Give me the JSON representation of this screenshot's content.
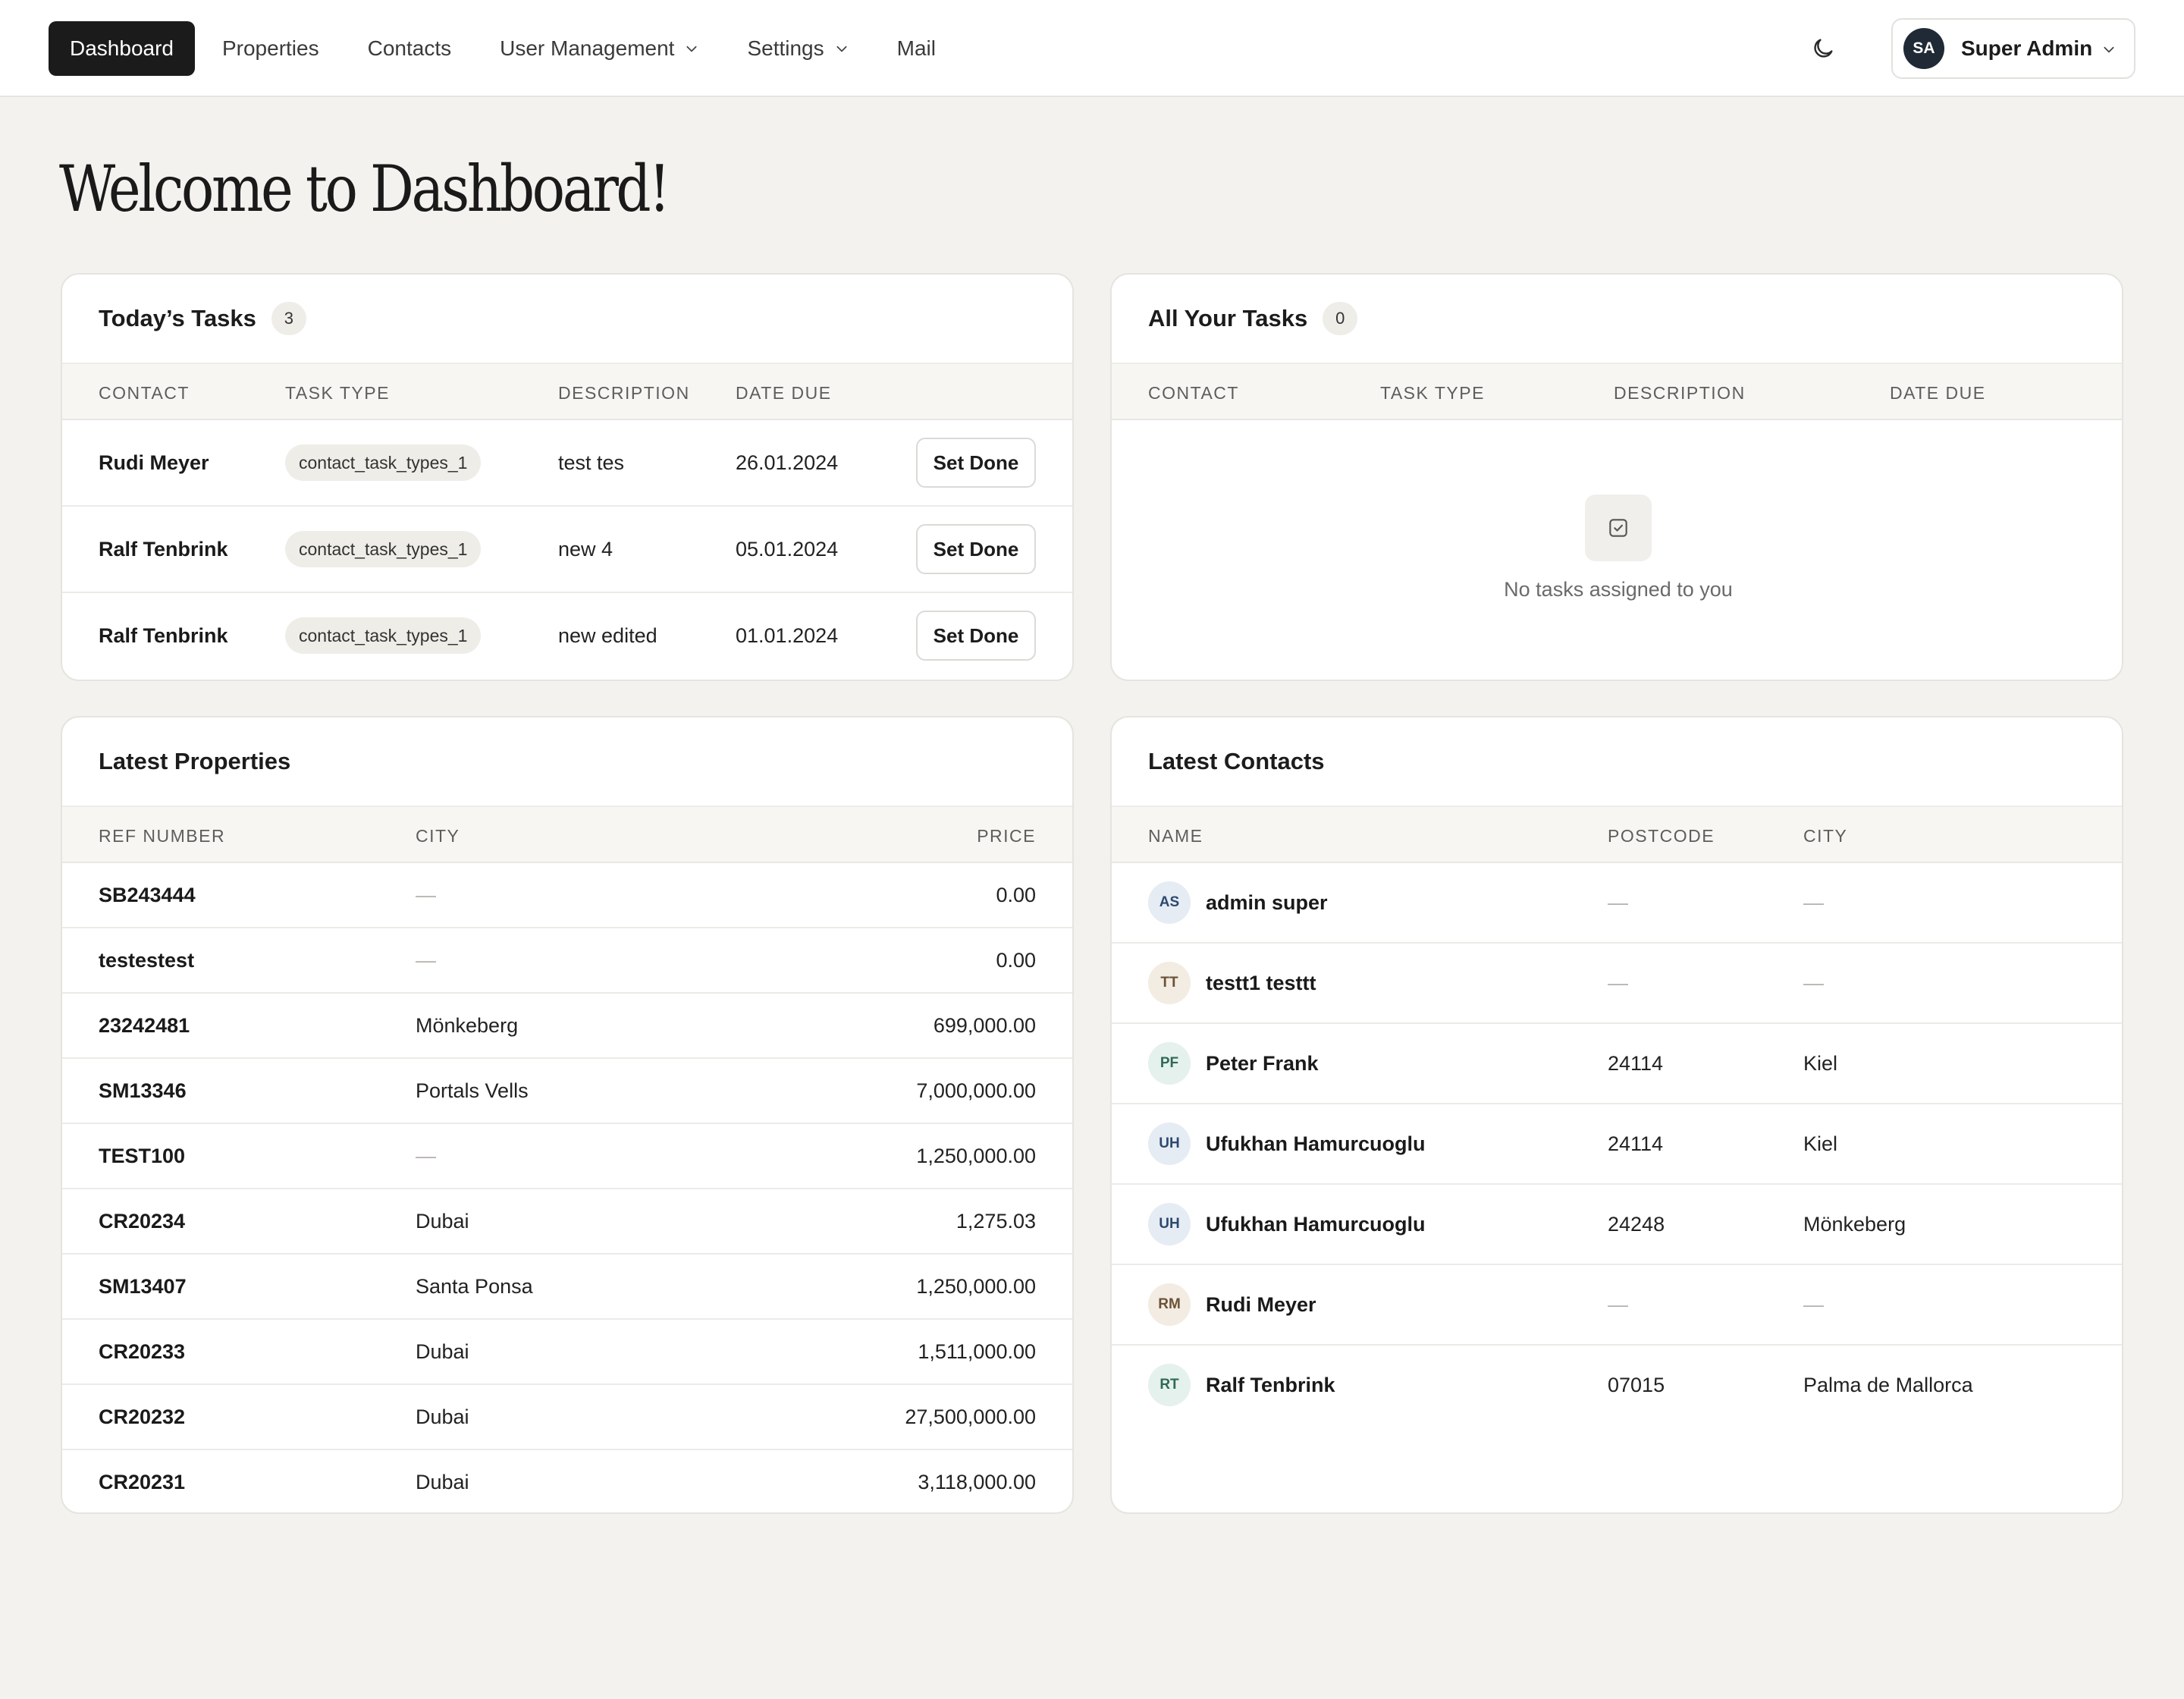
{
  "nav": {
    "items": [
      {
        "label": "Dashboard",
        "active": true
      },
      {
        "label": "Properties"
      },
      {
        "label": "Contacts"
      },
      {
        "label": "User Management",
        "dropdown": true
      },
      {
        "label": "Settings",
        "dropdown": true
      },
      {
        "label": "Mail"
      }
    ],
    "theme_icon": "moon-icon",
    "user": {
      "initials": "SA",
      "name": "Super Admin"
    }
  },
  "page": {
    "title": "Welcome to Dashboard!"
  },
  "todays_tasks": {
    "title": "Today’s Tasks",
    "count": "3",
    "columns": [
      "Contact",
      "Task Type",
      "Description",
      "Date Due"
    ],
    "rows": [
      {
        "contact": "Rudi Meyer",
        "task_type": "contact_task_types_1",
        "description": "test tes",
        "date_due": "26.01.2024",
        "action": "Set Done"
      },
      {
        "contact": "Ralf Tenbrink",
        "task_type": "contact_task_types_1",
        "description": "new 4",
        "date_due": "05.01.2024",
        "action": "Set Done"
      },
      {
        "contact": "Ralf Tenbrink",
        "task_type": "contact_task_types_1",
        "description": "new edited",
        "date_due": "01.01.2024",
        "action": "Set Done"
      }
    ]
  },
  "all_tasks": {
    "title": "All Your Tasks",
    "count": "0",
    "columns": [
      "Contact",
      "Task Type",
      "Description",
      "Date Due"
    ],
    "empty_text": "No tasks assigned to you",
    "empty_icon": "checkbox-icon"
  },
  "latest_properties": {
    "title": "Latest Properties",
    "columns": [
      "Ref Number",
      "City",
      "Price"
    ],
    "rows": [
      {
        "ref": "SB243444",
        "city": "—",
        "price": "0.00"
      },
      {
        "ref": "testestest",
        "city": "—",
        "price": "0.00"
      },
      {
        "ref": "23242481",
        "city": "Mönkeberg",
        "price": "699,000.00"
      },
      {
        "ref": "SM13346",
        "city": "Portals Vells",
        "price": "7,000,000.00"
      },
      {
        "ref": "TEST100",
        "city": "—",
        "price": "1,250,000.00"
      },
      {
        "ref": "CR20234",
        "city": "Dubai",
        "price": "1,275.03"
      },
      {
        "ref": "SM13407",
        "city": "Santa Ponsa",
        "price": "1,250,000.00"
      },
      {
        "ref": "CR20233",
        "city": "Dubai",
        "price": "1,511,000.00"
      },
      {
        "ref": "CR20232",
        "city": "Dubai",
        "price": "27,500,000.00"
      },
      {
        "ref": "CR20231",
        "city": "Dubai",
        "price": "3,118,000.00"
      }
    ]
  },
  "latest_contacts": {
    "title": "Latest Contacts",
    "columns": [
      "Name",
      "Postcode",
      "City"
    ],
    "rows": [
      {
        "initials": "AS",
        "name": "admin super",
        "postcode": "—",
        "city": "—",
        "avatar_color": "blue"
      },
      {
        "initials": "TT",
        "name": "testt1 testtt",
        "postcode": "—",
        "city": "—",
        "avatar_color": "sand"
      },
      {
        "initials": "PF",
        "name": "Peter Frank",
        "postcode": "24114",
        "city": "Kiel",
        "avatar_color": "green"
      },
      {
        "initials": "UH",
        "name": "Ufukhan Hamurcuoglu",
        "postcode": "24114",
        "city": "Kiel",
        "avatar_color": "blue"
      },
      {
        "initials": "UH",
        "name": "Ufukhan Hamurcuoglu",
        "postcode": "24248",
        "city": "Mönkeberg",
        "avatar_color": "blue"
      },
      {
        "initials": "RM",
        "name": "Rudi Meyer",
        "postcode": "—",
        "city": "—",
        "avatar_color": "sand"
      },
      {
        "initials": "RT",
        "name": "Ralf Tenbrink",
        "postcode": "07015",
        "city": "Palma de Mallorca",
        "avatar_color": "green"
      }
    ]
  }
}
